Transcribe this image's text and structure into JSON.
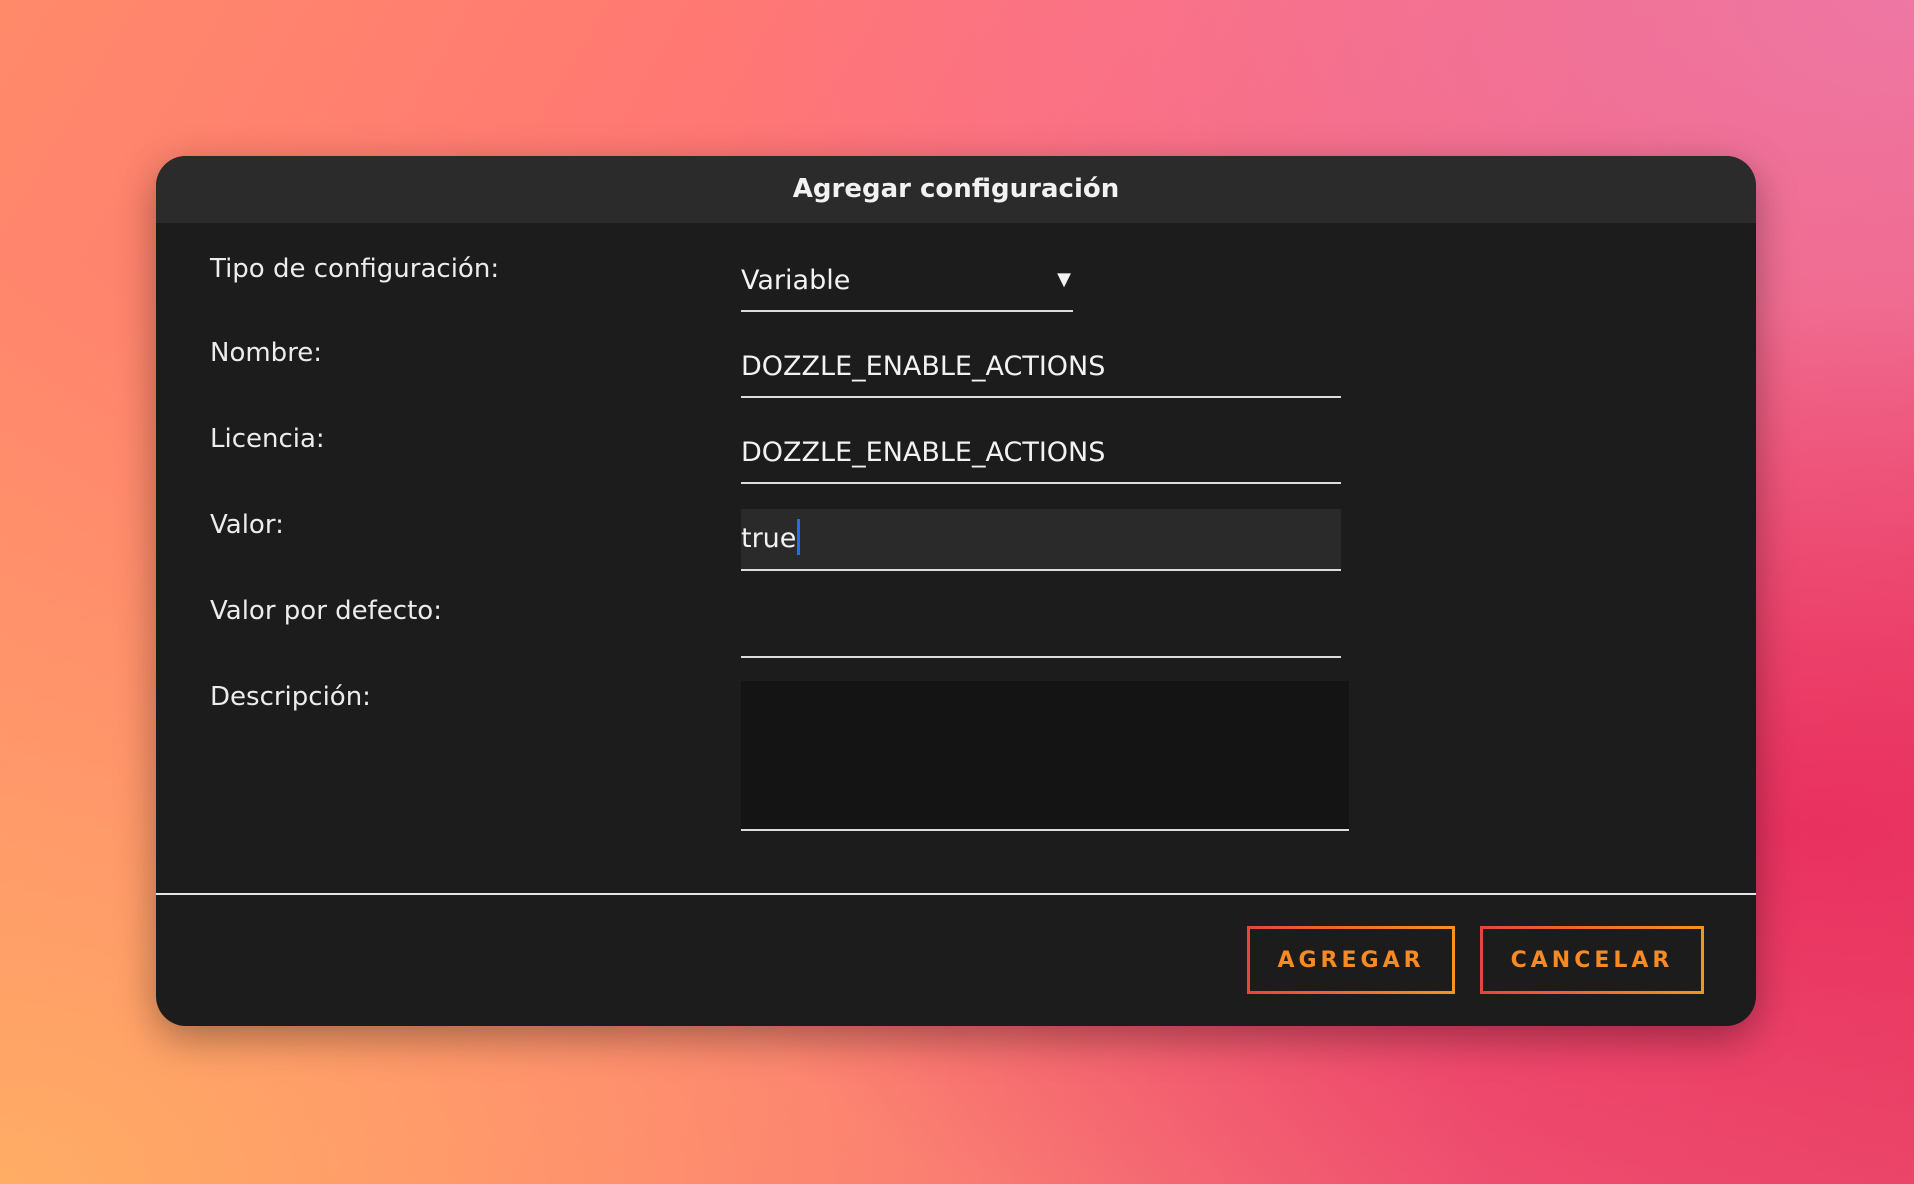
{
  "dialog": {
    "title": "Agregar configuración"
  },
  "form": {
    "tipo": {
      "label": "Tipo de configuración:",
      "value": "Variable",
      "arrow": "▼"
    },
    "nombre": {
      "label": "Nombre:",
      "value": "DOZZLE_ENABLE_ACTIONS"
    },
    "licencia": {
      "label": "Licencia:",
      "value": "DOZZLE_ENABLE_ACTIONS"
    },
    "valor": {
      "label": "Valor:",
      "value": "true"
    },
    "defecto": {
      "label": "Valor por defecto:",
      "value": ""
    },
    "descripcion": {
      "label": "Descripción:",
      "value": ""
    }
  },
  "buttons": {
    "add_label": "AGREGAR",
    "cancel_label": "CANCELAR"
  },
  "colors": {
    "dialog_bg": "#1c1c1c",
    "titlebar_bg": "#2b2b2b",
    "accent_orange": "#f68a24",
    "accent_red": "#e8453c",
    "caret_blue": "#1a73e8"
  }
}
